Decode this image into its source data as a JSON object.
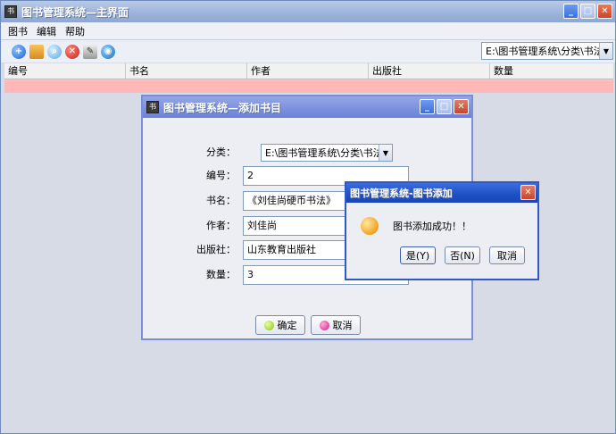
{
  "main": {
    "title": "图书管理系统—主界面",
    "menu": [
      "图书",
      "编辑",
      "帮助"
    ],
    "category_select": "E:\\图书管理系统\\分类\\书法",
    "table_headers": [
      "编号",
      "书名",
      "作者",
      "出版社",
      "数量"
    ],
    "window_icon_text": "书"
  },
  "toolbar_icons": [
    "add-icon",
    "open-book-icon",
    "search-icon",
    "delete-icon",
    "edit-icon",
    "web-icon"
  ],
  "add_dialog": {
    "title": "图书管理系统—添加书目",
    "labels": {
      "category": "分类：",
      "id": "编号：",
      "title": "书名：",
      "author": "作者：",
      "publisher": "出版社：",
      "quantity": "数量："
    },
    "values": {
      "category": "E:\\图书管理系统\\分类\\书法",
      "id": "2",
      "title": "《刘佳尚硬币书法》",
      "author": "刘佳尚",
      "publisher": "山东教育出版社",
      "quantity": "3"
    },
    "confirm_label": "确定",
    "cancel_label": "取消"
  },
  "message_box": {
    "title": "图书管理系统-图书添加",
    "message": "图书添加成功！！",
    "yes_label": "是(Y)",
    "no_label": "否(N)",
    "cancel_label": "取消"
  },
  "colors": {
    "selected_row": "#ffb7b7",
    "dialog_title": "#7b8fdd",
    "message_title": "#1f4fc4"
  }
}
